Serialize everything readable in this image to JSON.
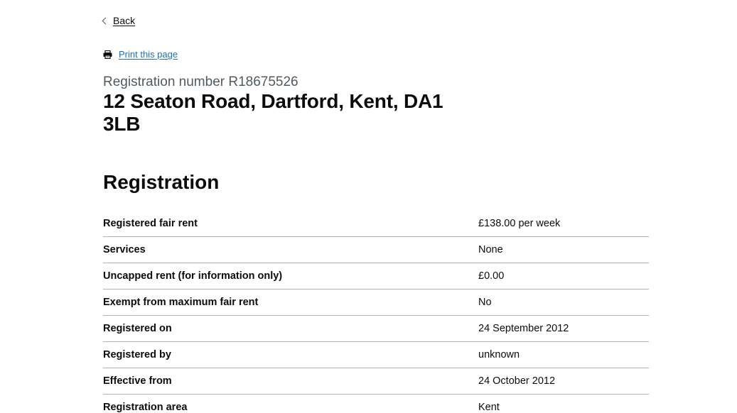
{
  "nav": {
    "back_label": "Back",
    "print_label": "Print this page"
  },
  "header": {
    "caption": "Registration number R18675526",
    "title": "12 Seaton Road, Dartford, Kent, DA1 3LB"
  },
  "registration": {
    "heading": "Registration",
    "rows": [
      {
        "key": "Registered fair rent",
        "value": "£138.00 per week"
      },
      {
        "key": "Services",
        "value": "None"
      },
      {
        "key": "Uncapped rent (for information only)",
        "value": "£0.00"
      },
      {
        "key": "Exempt from maximum fair rent",
        "value": "No"
      },
      {
        "key": "Registered on",
        "value": "24 September 2012"
      },
      {
        "key": "Registered by",
        "value": "unknown"
      },
      {
        "key": "Effective from",
        "value": "24 October 2012"
      },
      {
        "key": "Registration area",
        "value": "Kent"
      }
    ]
  },
  "icons": {
    "back": "chevron-left-icon",
    "print": "printer-icon"
  }
}
